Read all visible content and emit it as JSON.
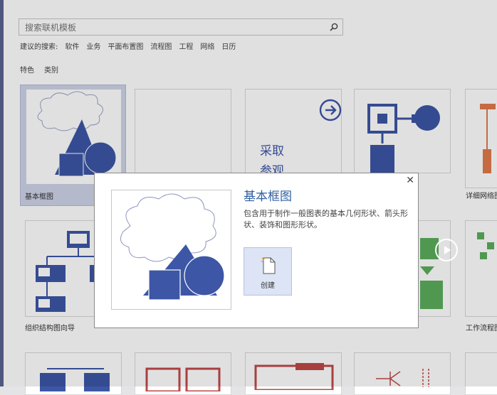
{
  "search": {
    "placeholder": "搜索联机模板"
  },
  "suggested": {
    "label": "建议的搜索:",
    "items": [
      "软件",
      "业务",
      "平面布置图",
      "流程图",
      "工程",
      "网络",
      "日历"
    ]
  },
  "tabs": [
    "特色",
    "类别"
  ],
  "tiles": {
    "basic": {
      "caption": "基本框图"
    },
    "learn": {
      "line1": "采取",
      "line2": "参观"
    },
    "network_detail": {
      "caption": "详细网络图"
    },
    "org_wizard": {
      "caption": "组织结构图向导"
    },
    "workflow": {
      "caption": "工作流程图"
    }
  },
  "dialog": {
    "title": "基本框图",
    "description": "包含用于制作一般图表的基本几何形状、箭头形状、装饰和图形形状。",
    "create_label": "创建",
    "close_glyph": "✕"
  },
  "colors": {
    "accent": "#2f5fa0",
    "shape_fill": "#3d56a6",
    "sidebar": "#5a6491"
  }
}
